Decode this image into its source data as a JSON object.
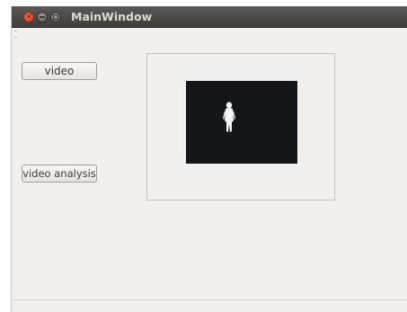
{
  "window": {
    "title": "MainWindow",
    "controls": {
      "close_icon": "close-icon",
      "minimize_icon": "minimize-icon",
      "maximize_icon": "maximize-icon"
    }
  },
  "buttons": {
    "video_label": "video",
    "video_analysis_label": "video analysis"
  },
  "video_panel": {
    "background_color": "#15161a",
    "content": "person-silhouette"
  },
  "colors": {
    "titlebar": "#3f3e3a",
    "window_bg": "#f1f0ef",
    "close_button": "#e2522a"
  }
}
